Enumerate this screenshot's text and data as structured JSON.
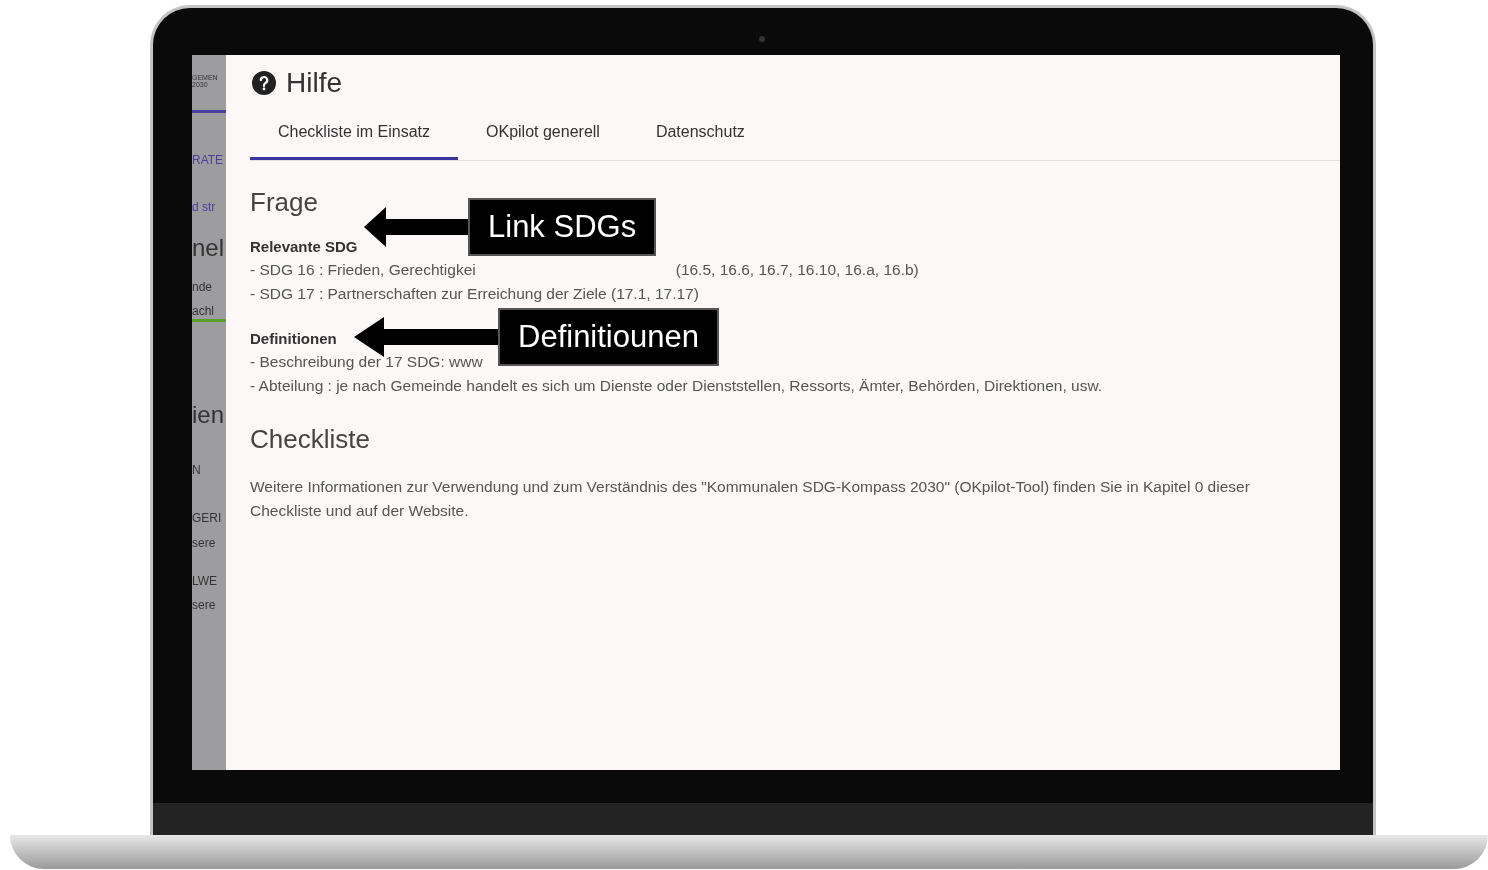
{
  "sidebar_fragments": [
    {
      "kind": "logo",
      "text": "GEMEN\n2030"
    },
    {
      "kind": "rule",
      "color": "#4b3fa0"
    },
    {
      "kind": "link",
      "text": "RATE"
    },
    {
      "kind": "link",
      "text": "d str"
    },
    {
      "kind": "heading",
      "text": "nel"
    },
    {
      "kind": "text",
      "text": "nde"
    },
    {
      "kind": "text",
      "text": "achl"
    },
    {
      "kind": "rule",
      "color": "#5aa02c"
    },
    {
      "kind": "heading",
      "text": "ien"
    },
    {
      "kind": "text",
      "text": "N"
    },
    {
      "kind": "text",
      "text": "GERI"
    },
    {
      "kind": "text",
      "text": "sere"
    },
    {
      "kind": "text",
      "text": "LWE"
    },
    {
      "kind": "text",
      "text": "sere"
    }
  ],
  "title": "Hilfe",
  "tabs": [
    {
      "label": "Checkliste im Einsatz",
      "selected": true
    },
    {
      "label": "OKpilot generell",
      "selected": false
    },
    {
      "label": "Datenschutz",
      "selected": false
    }
  ],
  "sections": [
    {
      "heading": "Frage",
      "groups": [
        {
          "title": "Relevante SDG",
          "lines": [
            [
              "- SDG 16 : Frieden, Gerechtigkei",
              "(16.5, 16.6, 16.7, 16.10, 16.a, 16.b)"
            ],
            [
              "- SDG 17 : Partnerschaften zur Erreichung der Ziele (17.1, 17.17)"
            ]
          ]
        },
        {
          "title": "Definitionen",
          "lines": [
            [
              "- Beschreibung der 17 SDG: www"
            ],
            [
              "- Abteilung : je nach Gemeinde handelt es sich um Dienste oder Dienststellen, Ressorts, Ämter, Behörden, Direktionen, usw."
            ]
          ]
        }
      ]
    },
    {
      "heading": "Checkliste",
      "paragraph": "Weitere Informationen zur Verwendung und zum Verständnis des \"Kommunalen SDG-Kompass 2030\" (OKpilot-Tool) finden Sie in Kapitel 0 dieser Checkliste und auf der Website."
    }
  ],
  "callouts": [
    "Link SDGs",
    "Definitiounen"
  ]
}
